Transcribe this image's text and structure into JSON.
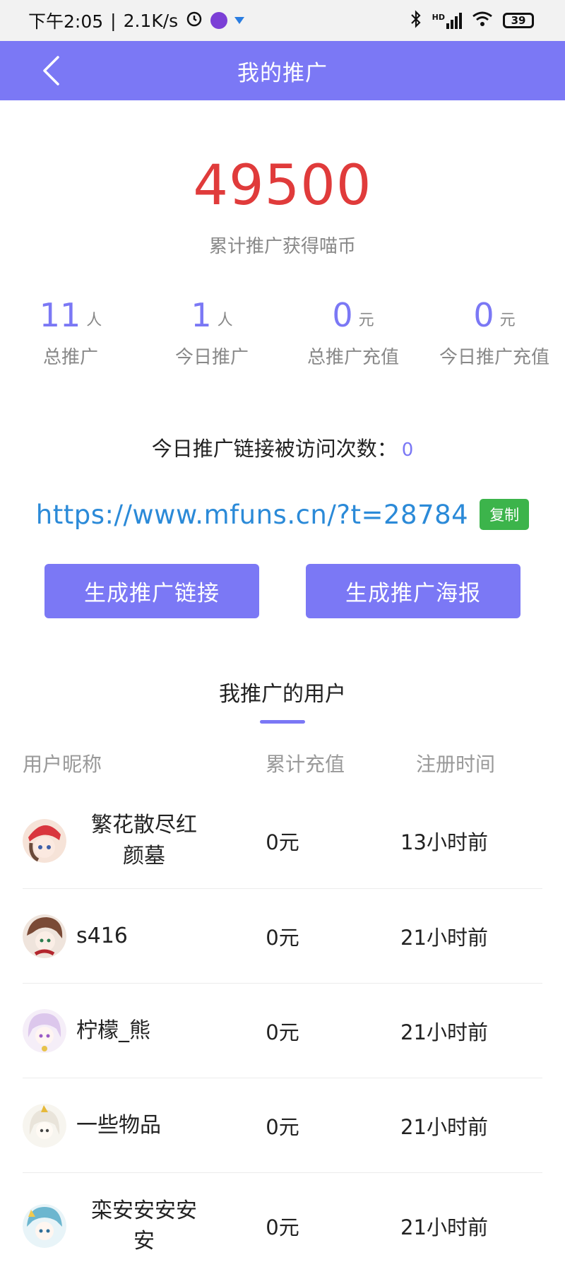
{
  "status_bar": {
    "time": "下午2:05",
    "separator": "|",
    "speed": "2.1K/s",
    "network": "HD",
    "battery": "39"
  },
  "navbar": {
    "title": "我的推广"
  },
  "summary": {
    "total_coins": "49500",
    "total_coins_label": "累计推广获得喵币"
  },
  "stats": [
    {
      "value": "11",
      "unit": "人",
      "label": "总推广"
    },
    {
      "value": "1",
      "unit": "人",
      "label": "今日推广"
    },
    {
      "value": "0",
      "unit": "元",
      "label": "总推广充值"
    },
    {
      "value": "0",
      "unit": "元",
      "label": "今日推广充值"
    }
  ],
  "visits": {
    "label": "今日推广链接被访问次数：",
    "count": "0"
  },
  "link": {
    "url": "https://www.mfuns.cn/?t=28784",
    "copy_label": "复制"
  },
  "buttons": {
    "generate_link": "生成推广链接",
    "generate_poster": "生成推广海报"
  },
  "section": {
    "title": "我推广的用户"
  },
  "table": {
    "headers": [
      "用户昵称",
      "累计充值",
      "注册时间"
    ],
    "rows": [
      {
        "name_line1": "繁花散尽红",
        "name_line2": "颜墓",
        "recharge": "0元",
        "time": "13小时前",
        "avatar_color": "#e9b7a8"
      },
      {
        "name_line1": "s416",
        "name_line2": "",
        "recharge": "0元",
        "time": "21小时前",
        "avatar_color": "#8a5a44"
      },
      {
        "name_line1": "柠檬_熊",
        "name_line2": "",
        "recharge": "0元",
        "time": "21小时前",
        "avatar_color": "#e6d4ef"
      },
      {
        "name_line1": "一些物品",
        "name_line2": "",
        "recharge": "0元",
        "time": "21小时前",
        "avatar_color": "#f1eee6"
      },
      {
        "name_line1": "栾安安安安",
        "name_line2": "安",
        "recharge": "0元",
        "time": "21小时前",
        "avatar_color": "#a9d7e6"
      }
    ]
  },
  "colors": {
    "accent": "#7b78f5",
    "total_red": "#e03b3b",
    "link_blue": "#2b8ad8",
    "copy_green": "#3cb44b"
  }
}
